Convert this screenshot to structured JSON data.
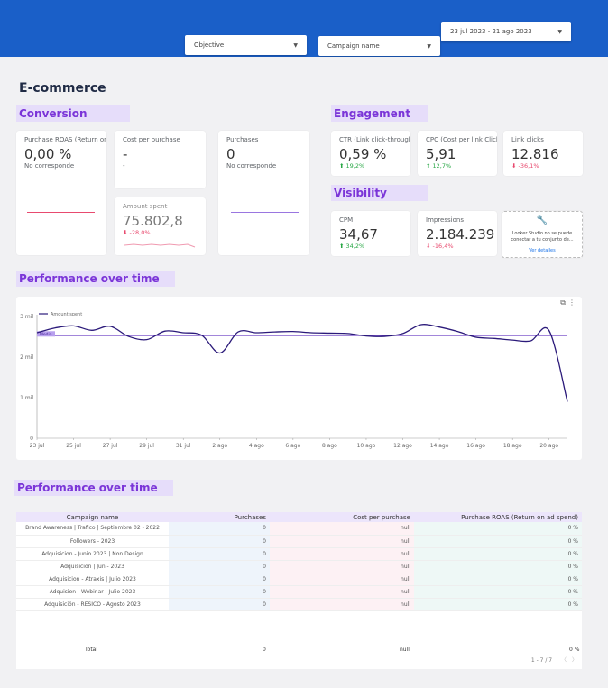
{
  "filters": {
    "objective": "Objective",
    "campaign": "Campaign name",
    "date_range": "23 jul 2023 - 21 ago 2023"
  },
  "page_title": "E-commerce",
  "sections": {
    "conversion": "Conversion",
    "engagement": "Engagement",
    "visibility": "Visibility",
    "performance_chart": "Performance over time",
    "performance_table": "Performance over time"
  },
  "kpis": {
    "roas": {
      "label": "Purchase ROAS (Return on ad spend)",
      "value": "0,00 %",
      "sub": "No corresponde"
    },
    "cost_per_purchase": {
      "label": "Cost per purchase",
      "value": "-",
      "sub": "-"
    },
    "purchases": {
      "label": "Purchases",
      "value": "0",
      "sub": "No corresponde"
    },
    "amount_spent": {
      "label": "Amount spent",
      "value": "75.802,8",
      "delta": "-28,0%"
    },
    "ctr": {
      "label": "CTR (Link click-through rate)",
      "value": "0,59 %",
      "delta": "19,2%"
    },
    "cpc": {
      "label": "CPC (Cost per link Click)",
      "value": "5,91",
      "delta": "12,7%"
    },
    "link_clicks": {
      "label": "Link clicks",
      "value": "12.816",
      "delta": "-36,1%"
    },
    "cpm": {
      "label": "CPM",
      "value": "34,67",
      "delta": "34,2%"
    },
    "impressions": {
      "label": "Impressions",
      "value": "2.184.239",
      "delta": "-16,4%"
    },
    "looker_error": {
      "text": "Looker Studio no se puede conectar a tu conjunto de...",
      "link": "Ver detalles"
    }
  },
  "colors": {
    "topbar": "#1a5fc8",
    "section_fg": "#7b35d8",
    "section_bg": "#e6ddfa",
    "line": "#2b1a7a",
    "up": "#28a745",
    "down": "#e84a6f"
  },
  "chart_data": {
    "type": "line",
    "legend": "Amount spent",
    "ref_line_label": "Media",
    "x_ticks": [
      "23 jul",
      "25 jul",
      "27 jul",
      "29 jul",
      "31 jul",
      "2 ago",
      "4 ago",
      "6 ago",
      "8 ago",
      "10 ago",
      "12 ago",
      "14 ago",
      "16 ago",
      "18 ago",
      "20 ago"
    ],
    "y_ticks": [
      "0",
      "1 mil",
      "2 mil",
      "3 mil"
    ],
    "ylim": [
      0,
      3000
    ],
    "reference_value": 2527,
    "x": [
      "23 jul",
      "24 jul",
      "25 jul",
      "26 jul",
      "27 jul",
      "28 jul",
      "29 jul",
      "30 jul",
      "31 jul",
      "1 ago",
      "2 ago",
      "3 ago",
      "4 ago",
      "5 ago",
      "6 ago",
      "7 ago",
      "8 ago",
      "9 ago",
      "10 ago",
      "11 ago",
      "12 ago",
      "13 ago",
      "14 ago",
      "15 ago",
      "16 ago",
      "17 ago",
      "18 ago",
      "19 ago",
      "20 ago",
      "21 ago"
    ],
    "values": [
      2600,
      2720,
      2770,
      2660,
      2760,
      2510,
      2430,
      2640,
      2600,
      2540,
      2100,
      2620,
      2600,
      2620,
      2630,
      2600,
      2590,
      2580,
      2520,
      2510,
      2580,
      2800,
      2740,
      2630,
      2490,
      2460,
      2420,
      2400,
      2650,
      900
    ]
  },
  "table": {
    "headers": [
      "Campaign name",
      "Purchases",
      "Cost per purchase",
      "Purchase ROAS (Return on ad spend)"
    ],
    "rows": [
      [
        "Brand Awareness | Trafico | Septiembre 02 - 2022",
        "0",
        "null",
        "0 %"
      ],
      [
        "Followers - 2023",
        "0",
        "null",
        "0 %"
      ],
      [
        "Adquisicion - Junio 2023 | Non Design",
        "0",
        "null",
        "0 %"
      ],
      [
        "Adquisicion | Jun - 2023",
        "0",
        "null",
        "0 %"
      ],
      [
        "Adquisicion - Atraxis | Julio 2023",
        "0",
        "null",
        "0 %"
      ],
      [
        "Adquision - Webinar | Julio 2023",
        "0",
        "null",
        "0 %"
      ],
      [
        "Adquisición - RESICO - Agosto 2023",
        "0",
        "null",
        "0 %"
      ]
    ],
    "total_label": "Total",
    "totals": [
      "0",
      "null",
      "0 %"
    ],
    "pager": "1 - 7 / 7"
  }
}
